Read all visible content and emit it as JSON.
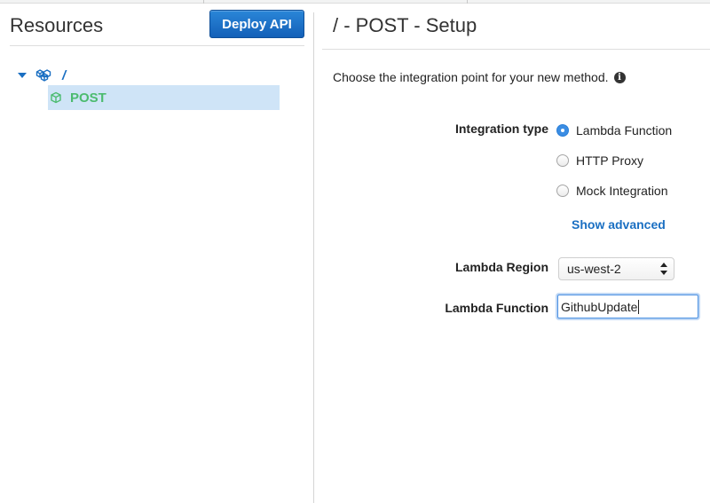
{
  "left": {
    "title": "Resources",
    "deploy_button": "Deploy API",
    "tree": {
      "root_label": "/",
      "child_label": "POST"
    }
  },
  "right": {
    "title": "/ - POST - Setup",
    "intro": "Choose the integration point for your new method.",
    "integration_type_label": "Integration type",
    "options": [
      {
        "label": "Lambda Function",
        "checked": true
      },
      {
        "label": "HTTP Proxy",
        "checked": false
      },
      {
        "label": "Mock Integration",
        "checked": false
      }
    ],
    "show_advanced": "Show advanced",
    "lambda_region_label": "Lambda Region",
    "lambda_region_value": "us-west-2",
    "lambda_function_label": "Lambda Function",
    "lambda_function_value": "GithubUpdate"
  },
  "colors": {
    "accent_blue": "#1a6fc2",
    "button_blue": "#1f74cc",
    "post_green": "#4cbb6f",
    "selection_bg": "#cfe4f7"
  }
}
